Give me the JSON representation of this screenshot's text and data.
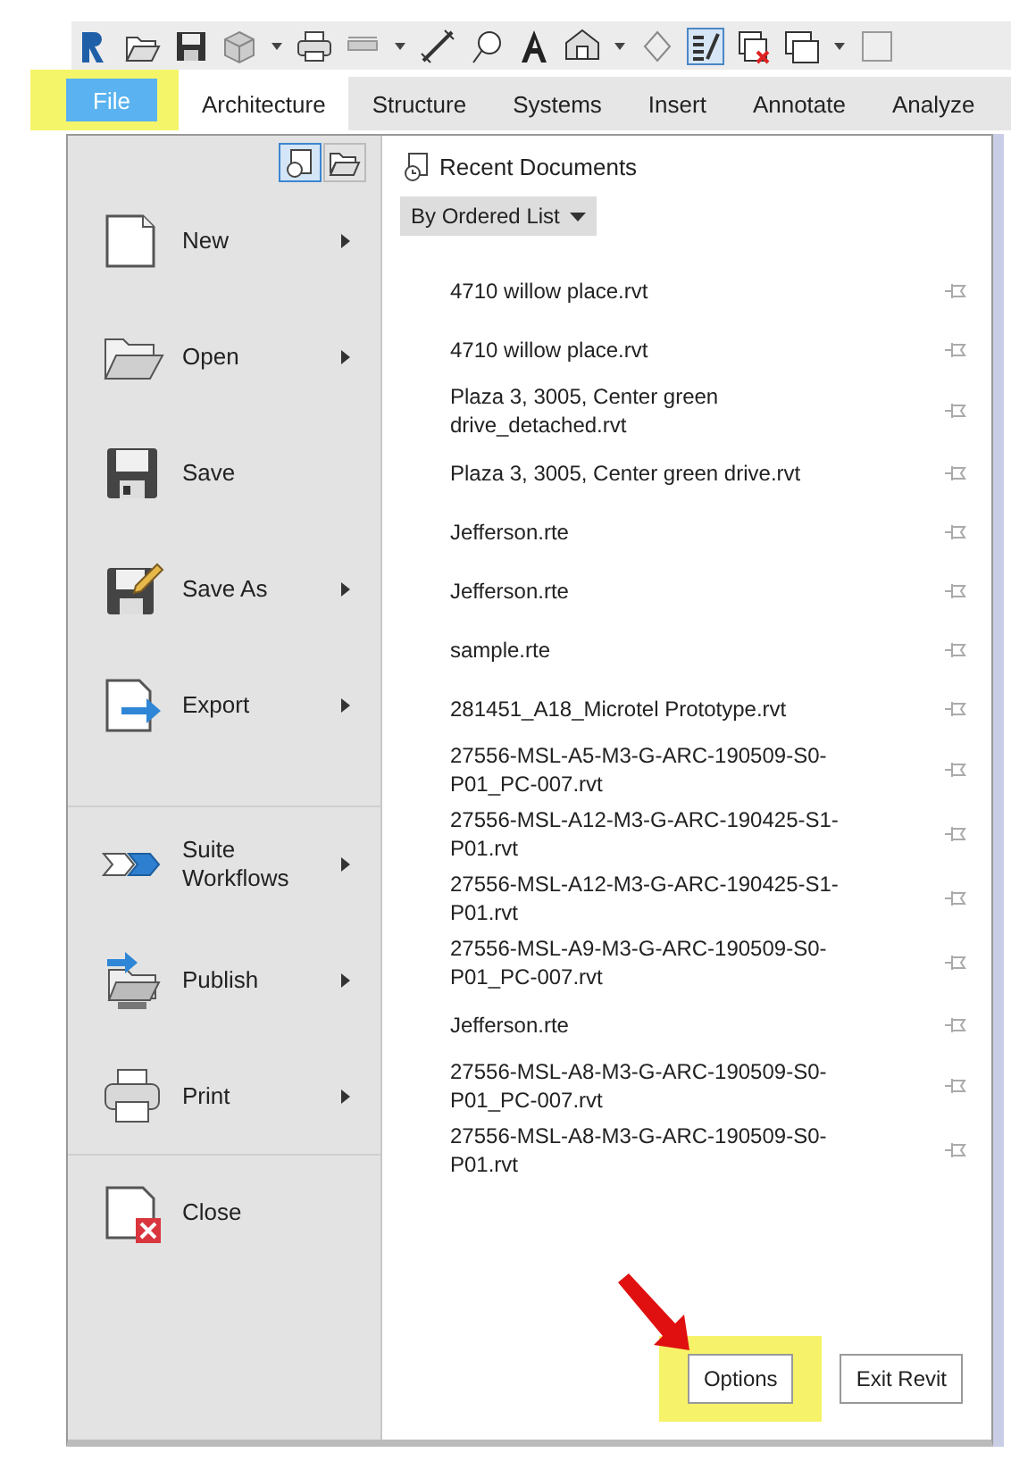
{
  "file_tab": {
    "label": "File",
    "open": true
  },
  "tabs": [
    {
      "label": "Architecture",
      "selected": true
    },
    {
      "label": "Structure",
      "selected": false
    },
    {
      "label": "Systems",
      "selected": false
    },
    {
      "label": "Insert",
      "selected": false
    },
    {
      "label": "Annotate",
      "selected": false
    },
    {
      "label": "Analyze",
      "selected": false
    }
  ],
  "menu": {
    "commands": [
      {
        "label": "New",
        "submenu": true,
        "separator_before": false
      },
      {
        "label": "Open",
        "submenu": true,
        "separator_before": false
      },
      {
        "label": "Save",
        "submenu": false,
        "separator_before": false
      },
      {
        "label": "Save As",
        "submenu": true,
        "separator_before": false
      },
      {
        "label": "Export",
        "submenu": true,
        "separator_before": false
      },
      {
        "label": "Suite Workflows",
        "submenu": true,
        "separator_before": true
      },
      {
        "label": "Publish",
        "submenu": true,
        "separator_before": false
      },
      {
        "label": "Print",
        "submenu": true,
        "separator_before": false
      },
      {
        "label": "Close",
        "submenu": false,
        "separator_before": true
      }
    ],
    "view_buttons": [
      {
        "selected": true
      },
      {
        "selected": false
      }
    ],
    "recent": {
      "title": "Recent Documents",
      "sort": "By Ordered List",
      "files": [
        {
          "name": "4710 willow place.rvt"
        },
        {
          "name": "4710 willow place.rvt"
        },
        {
          "name": "Plaza 3, 3005, Center green drive_detached.rvt"
        },
        {
          "name": "Plaza 3, 3005, Center green drive.rvt"
        },
        {
          "name": "Jefferson.rte"
        },
        {
          "name": "Jefferson.rte"
        },
        {
          "name": "sample.rte"
        },
        {
          "name": "281451_A18_Microtel Prototype.rvt"
        },
        {
          "name": "27556-MSL-A5-M3-G-ARC-190509-S0-P01_PC-007.rvt"
        },
        {
          "name": "27556-MSL-A12-M3-G-ARC-190425-S1-P01.rvt"
        },
        {
          "name": "27556-MSL-A12-M3-G-ARC-190425-S1-P01.rvt"
        },
        {
          "name": "27556-MSL-A9-M3-G-ARC-190509-S0-P01_PC-007.rvt"
        },
        {
          "name": "Jefferson.rte"
        },
        {
          "name": "27556-MSL-A8-M3-G-ARC-190509-S0-P01_PC-007.rvt"
        },
        {
          "name": "27556-MSL-A8-M3-G-ARC-190509-S0-P01.rvt"
        }
      ]
    },
    "buttons": [
      {
        "label": "Options",
        "highlighted": true
      },
      {
        "label": "Exit Revit",
        "highlighted": false
      }
    ]
  }
}
